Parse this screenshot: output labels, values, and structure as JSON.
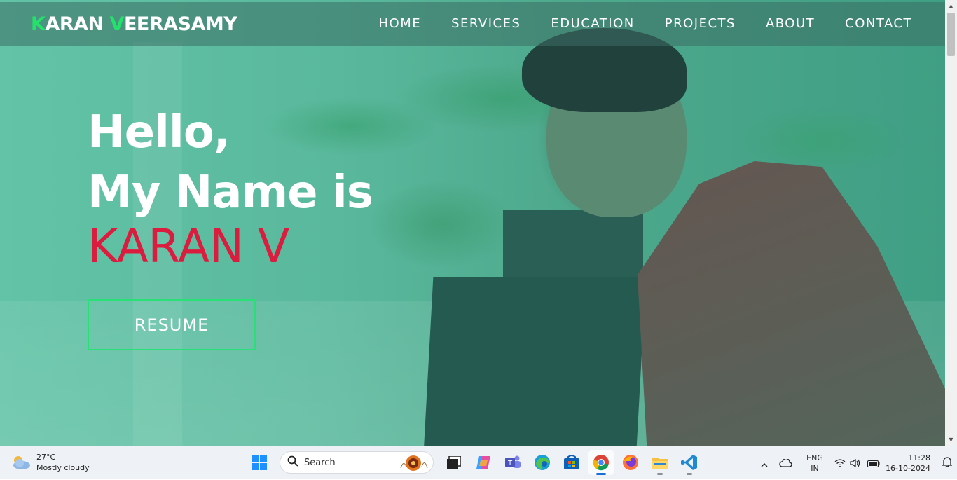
{
  "logo": {
    "first_initial": "K",
    "first_rest": "ARAN ",
    "second_initial": "V",
    "second_rest": "EERASAMY"
  },
  "nav": [
    "HOME",
    "SERVICES",
    "EDUCATION",
    "PROJECTS",
    "ABOUT",
    "CONTACT"
  ],
  "hero": {
    "line1": "Hello,",
    "line2": "My Name is",
    "name": "KARAN V",
    "button": "RESUME"
  },
  "colors": {
    "accent_green": "#22e36a",
    "name_red": "#dc1c3e",
    "overlay": "#5ab99d"
  },
  "taskbar": {
    "weather": {
      "temp": "27°C",
      "condition": "Mostly cloudy"
    },
    "search_placeholder": "Search",
    "language": {
      "lang": "ENG",
      "region": "IN"
    },
    "time": "11:28",
    "date": "16-10-2024"
  },
  "icons": [
    "windows-start-icon",
    "search-icon",
    "task-view-icon",
    "copilot-icon",
    "teams-icon",
    "edge-icon",
    "store-icon",
    "chrome-icon",
    "firefox-icon",
    "file-explorer-icon",
    "vscode-icon"
  ]
}
